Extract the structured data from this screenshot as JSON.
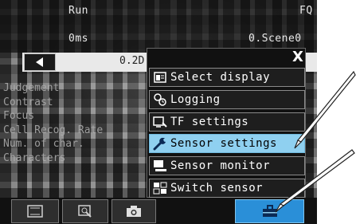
{
  "status": {
    "mode": "Run",
    "device": "FQ",
    "time": "0ms",
    "scene": "0.Scene0"
  },
  "nav": {
    "value": "0.2D"
  },
  "overlay_labels": [
    "Judgement",
    "Contrast",
    "Focus",
    "Cell Recog. Rate",
    "Num. of char.",
    "Characters"
  ],
  "menu": {
    "close_label": "X",
    "items": [
      {
        "label": "Select display",
        "icon": "display-icon"
      },
      {
        "label": "Logging",
        "icon": "logging-icon"
      },
      {
        "label": "TF settings",
        "icon": "tf-settings-icon"
      },
      {
        "label": "Sensor settings",
        "icon": "wrench-icon",
        "active": true
      },
      {
        "label": "Sensor monitor",
        "icon": "monitor-icon"
      },
      {
        "label": "Switch sensor",
        "icon": "switch-sensor-icon"
      }
    ]
  },
  "toolbar": {
    "buttons": [
      {
        "icon": "frame-icon"
      },
      {
        "icon": "zoom-icon"
      },
      {
        "icon": "camera-icon"
      },
      {
        "icon": "toolbox-icon"
      }
    ]
  },
  "colors": {
    "active_item": "#8fd0f0",
    "menu_button": "#2a8fd8"
  }
}
